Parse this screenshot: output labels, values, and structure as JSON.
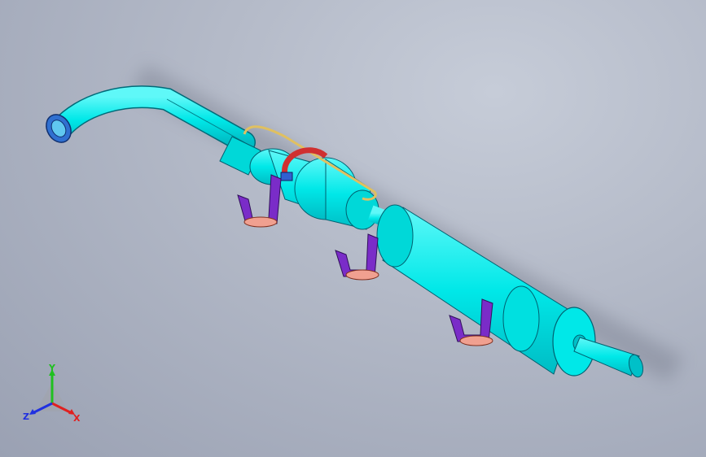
{
  "viewport": {
    "background_top": "#c6ccd8",
    "background_bottom": "#9aa1b3"
  },
  "model": {
    "body_color": "#00e8e8",
    "body_shadow": "#00b8c0",
    "hanger_color": "#7a2cc8",
    "pad_color": "#f0a090",
    "clamp_color": "#d03030",
    "wire_color": "#e0c060"
  },
  "triad": {
    "y_label": "Y",
    "x_label": "X",
    "z_label": "Z",
    "y_color": "#20c020",
    "x_color": "#e02020",
    "z_color": "#2030e0"
  }
}
